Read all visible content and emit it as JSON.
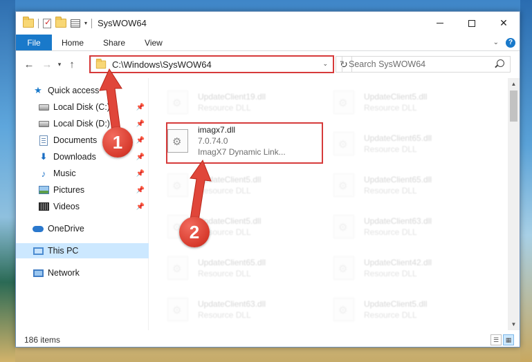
{
  "window": {
    "title": "SysWOW64"
  },
  "ribbon": {
    "tabs": [
      "File",
      "Home",
      "Share",
      "View"
    ]
  },
  "navbar": {
    "address": "C:\\Windows\\SysWOW64",
    "search_placeholder": "Search SysWOW64"
  },
  "sidebar": {
    "items": [
      {
        "label": "Quick access",
        "icon": "star-icon",
        "pinned": false
      },
      {
        "label": "Local Disk (C:)",
        "icon": "disk-icon",
        "pinned": true
      },
      {
        "label": "Local Disk (D:)",
        "icon": "disk-icon",
        "pinned": true
      },
      {
        "label": "Documents",
        "icon": "documents-icon",
        "pinned": true
      },
      {
        "label": "Downloads",
        "icon": "downloads-icon",
        "pinned": true
      },
      {
        "label": "Music",
        "icon": "music-icon",
        "pinned": true
      },
      {
        "label": "Pictures",
        "icon": "pictures-icon",
        "pinned": true
      },
      {
        "label": "Videos",
        "icon": "videos-icon",
        "pinned": true
      },
      {
        "label": "OneDrive",
        "icon": "onedrive-icon",
        "pinned": false
      },
      {
        "label": "This PC",
        "icon": "this-pc-icon",
        "pinned": false,
        "selected": true
      },
      {
        "label": "Network",
        "icon": "network-icon",
        "pinned": false
      }
    ]
  },
  "files": {
    "left_column": [
      {
        "name": "UpdateClient19.dll",
        "type": "Resource DLL"
      },
      {
        "name": "imagx7.dll",
        "version": "7.0.74.0",
        "type": "ImagX7 Dynamic Link...",
        "highlighted": true
      },
      {
        "name": "UpdateClient5.dll",
        "type": "Resource DLL"
      },
      {
        "name": "UpdateClient5.dll",
        "type": "Resource DLL"
      },
      {
        "name": "UpdateClient65.dll",
        "type": "Resource DLL"
      },
      {
        "name": "UpdateClient63.dll",
        "type": "Resource DLL"
      }
    ],
    "right_column": [
      {
        "name": "UpdateClient5.dll",
        "type": "Resource DLL"
      },
      {
        "name": "UpdateClient65.dll",
        "type": "Resource DLL"
      },
      {
        "name": "UpdateClient65.dll",
        "type": "Resource DLL"
      },
      {
        "name": "UpdateClient63.dll",
        "type": "Resource DLL"
      },
      {
        "name": "UpdateClient42.dll",
        "type": "Resource DLL"
      },
      {
        "name": "UpdateClient5.dll",
        "type": "Resource DLL"
      }
    ]
  },
  "status": {
    "item_count": "186 items"
  },
  "callouts": [
    {
      "number": "1"
    },
    {
      "number": "2"
    }
  ],
  "colors": {
    "accent": "#1979ca",
    "highlight": "#d63a3a",
    "selected_bg": "#cce8ff"
  }
}
